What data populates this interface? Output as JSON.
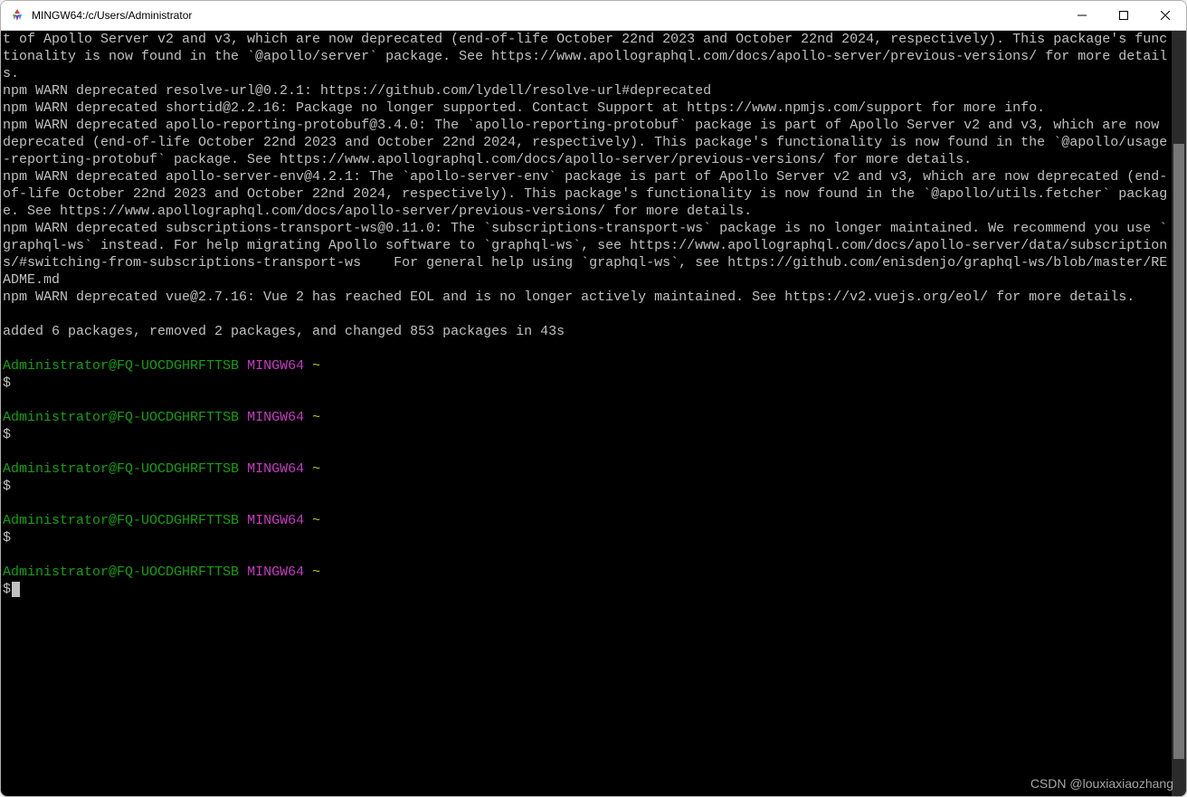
{
  "window": {
    "title": "MINGW64:/c/Users/Administrator"
  },
  "output": {
    "warn1": "t of Apollo Server v2 and v3, which are now deprecated (end-of-life October 22nd 2023 and October 22nd 2024, respectively). This package's functionality is now found in the `@apollo/server` package. See https://www.apollographql.com/docs/apollo-server/previous-versions/ for more details.",
    "warn2": "npm WARN deprecated resolve-url@0.2.1: https://github.com/lydell/resolve-url#deprecated",
    "warn3": "npm WARN deprecated shortid@2.2.16: Package no longer supported. Contact Support at https://www.npmjs.com/support for more info.",
    "warn4": "npm WARN deprecated apollo-reporting-protobuf@3.4.0: The `apollo-reporting-protobuf` package is part of Apollo Server v2 and v3, which are now deprecated (end-of-life October 22nd 2023 and October 22nd 2024, respectively). This package's functionality is now found in the `@apollo/usage-reporting-protobuf` package. See https://www.apollographql.com/docs/apollo-server/previous-versions/ for more details.",
    "warn5": "npm WARN deprecated apollo-server-env@4.2.1: The `apollo-server-env` package is part of Apollo Server v2 and v3, which are now deprecated (end-of-life October 22nd 2023 and October 22nd 2024, respectively). This package's functionality is now found in the `@apollo/utils.fetcher` package. See https://www.apollographql.com/docs/apollo-server/previous-versions/ for more details.",
    "warn6": "npm WARN deprecated subscriptions-transport-ws@0.11.0: The `subscriptions-transport-ws` package is no longer maintained. We recommend you use `graphql-ws` instead. For help migrating Apollo software to `graphql-ws`, see https://www.apollographql.com/docs/apollo-server/data/subscriptions/#switching-from-subscriptions-transport-ws    For general help using `graphql-ws`, see https://github.com/enisdenjo/graphql-ws/blob/master/README.md",
    "warn7": "npm WARN deprecated vue@2.7.16: Vue 2 has reached EOL and is no longer actively maintained. See https://v2.vuejs.org/eol/ for more details.",
    "summary": "added 6 packages, removed 2 packages, and changed 853 packages in 43s"
  },
  "prompt": {
    "user_host": "Administrator@FQ-UOCDGHRFTTSB",
    "env": "MINGW64",
    "path": "~",
    "symbol": "$"
  },
  "watermark": "CSDN @louxiaxiaozhang"
}
